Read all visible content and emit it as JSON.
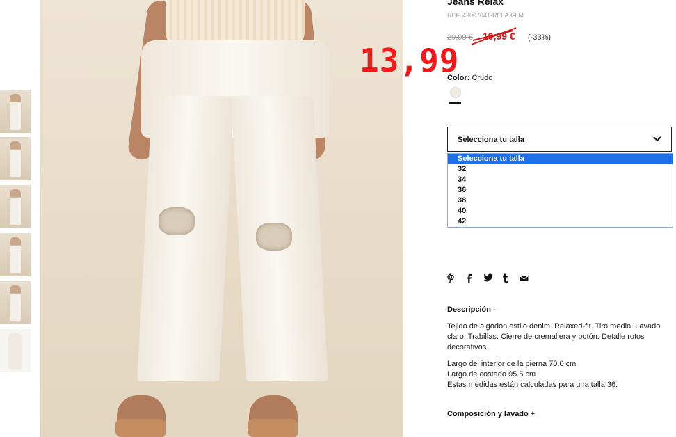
{
  "product": {
    "title": "Jeans Relax",
    "ref": "REF. 43007041-RELAX-LM",
    "old_price": "29,99 €",
    "sale_price": "19,99 €",
    "discount": "(-33%)",
    "overlay_price": "13,99",
    "color_label": "Color:",
    "color_value": "Crudo",
    "swatch_color": "#efeae0"
  },
  "size_select": {
    "selected": "Selecciona tu talla",
    "options": [
      "Selecciona tu talla",
      "32",
      "34",
      "36",
      "38",
      "40",
      "42"
    ]
  },
  "share_icons": [
    "pinterest-icon",
    "facebook-icon",
    "twitter-icon",
    "tumblr-icon",
    "mail-icon"
  ],
  "description": {
    "heading": "Descripción -",
    "paragraph1": "Tejido de algodón estilo denim. Relaxed-fit. Tiro medio. Lavado claro. Trabillas. Cierre de cremallera y botón. Detalle rotos decorativos.",
    "line1": "Largo del interior de la pierna 70.0 cm",
    "line2": "Largo de costado 95.5 cm",
    "line3": "Estas medidas están calculadas para una talla 36."
  },
  "composition": {
    "heading": "Composición y lavado +"
  },
  "colors": {
    "sale_red": "#d31b1b",
    "overlay_red": "#f51818",
    "highlight_blue": "#1e6fe8"
  }
}
